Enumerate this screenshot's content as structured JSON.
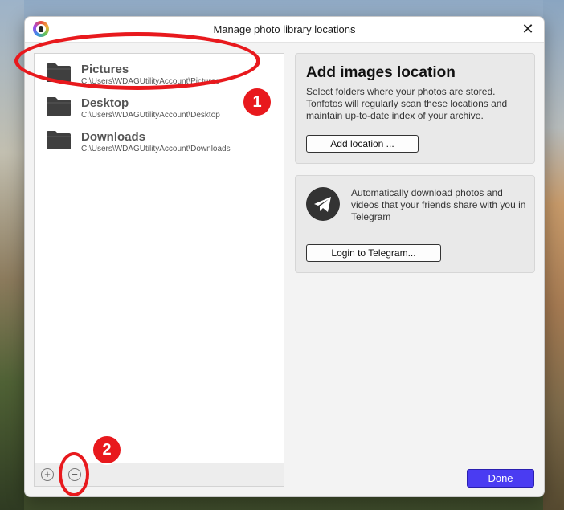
{
  "window": {
    "title": "Manage photo library locations",
    "close_symbol": "✕"
  },
  "locations": [
    {
      "name": "Pictures",
      "path": "C:\\Users\\WDAGUtilityAccount\\Pictures"
    },
    {
      "name": "Desktop",
      "path": "C:\\Users\\WDAGUtilityAccount\\Desktop"
    },
    {
      "name": "Downloads",
      "path": "C:\\Users\\WDAGUtilityAccount\\Downloads"
    }
  ],
  "footer": {
    "add_symbol": "+",
    "remove_symbol": "−"
  },
  "add_card": {
    "title": "Add images location",
    "description": "Select folders where your photos are stored. Tonfotos will regularly scan these locations and maintain up-to-date index of your archive.",
    "button": "Add location ..."
  },
  "telegram_card": {
    "description": "Automatically download photos and videos that your friends share with you in Telegram",
    "button": "Login to Telegram..."
  },
  "done_button": "Done",
  "annotations": {
    "badge_1": "1",
    "badge_2": "2"
  },
  "colors": {
    "accent": "#4a3cf2",
    "annotation": "#e8191d"
  }
}
